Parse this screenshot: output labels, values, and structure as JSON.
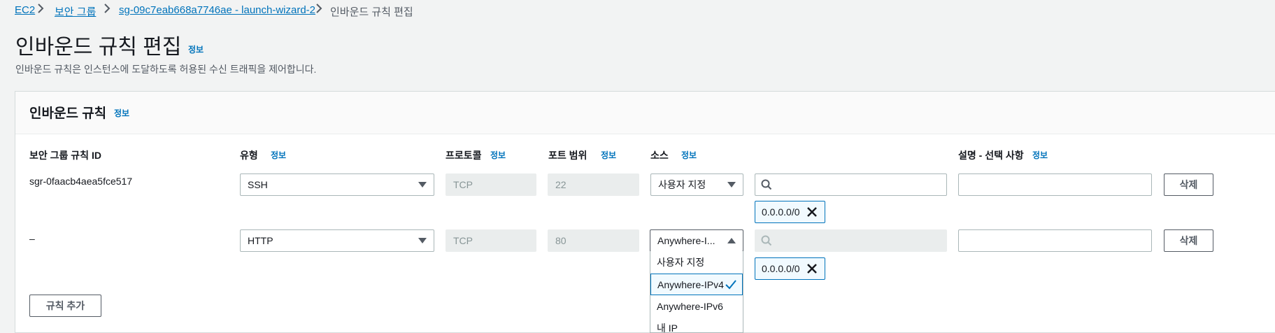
{
  "breadcrumb": {
    "items": [
      "EC2",
      "보안 그룹",
      "sg-09c7eab668a7746ae - launch-wizard-2"
    ],
    "current": "인바운드 규칙 편집"
  },
  "page": {
    "title": "인바운드 규칙 편집",
    "title_info": "정보",
    "description": "인바운드 규칙은 인스턴스에 도달하도록 허용된 수신 트래픽을 제어합니다."
  },
  "panel": {
    "title": "인바운드 규칙",
    "title_info": "정보",
    "columns": {
      "rule_id": "보안 그룹 규칙 ID",
      "type": "유형",
      "protocol": "프로토콜",
      "port_range": "포트 범위",
      "source": "소스",
      "description": "설명 - 선택 사항",
      "info": "정보"
    },
    "rows": [
      {
        "rule_id": "sgr-0faacb4aea5fce517",
        "type": "SSH",
        "protocol": "TCP",
        "port": "22",
        "source": "사용자 지정",
        "token": "0.0.0.0/0",
        "delete": "삭제"
      },
      {
        "rule_id": "–",
        "type": "HTTP",
        "protocol": "TCP",
        "port": "80",
        "source": "Anywhere-I...",
        "token": "0.0.0.0/0",
        "delete": "삭제"
      }
    ],
    "add_rule": "규칙 추가"
  },
  "source_dropdown": {
    "options": [
      "사용자 지정",
      "Anywhere-IPv4",
      "Anywhere-IPv6",
      "내 IP"
    ],
    "selected": "Anywhere-IPv4"
  },
  "icons": {
    "search": "search-icon",
    "close": "close-icon",
    "check": "check-icon",
    "chevron_right": "chevron-right-icon"
  },
  "colors": {
    "link": "#0073bb",
    "background": "#f2f3f3",
    "token_bg": "#f1faff"
  }
}
